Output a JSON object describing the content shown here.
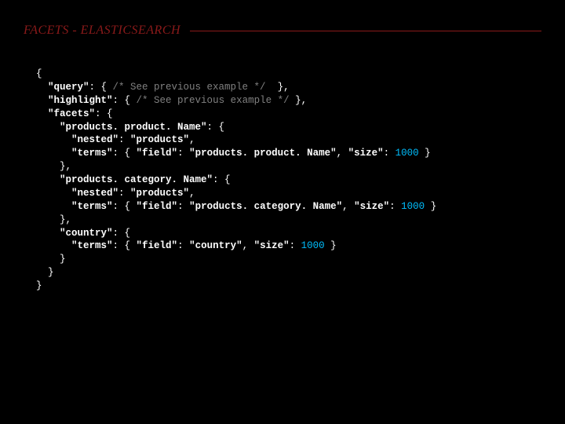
{
  "header": {
    "title": "FACETS - ELASTICSEARCH"
  },
  "code": {
    "l01": "{",
    "l02_a": "  \"query\"",
    "l02_b": ": { ",
    "l02_c": "/* See previous example */",
    "l02_d": "  },",
    "l03_a": "  \"highlight\"",
    "l03_b": ": { ",
    "l03_c": "/* See previous example */",
    "l03_d": " },",
    "l04_a": "  \"facets\"",
    "l04_b": ": {",
    "l05_a": "    \"products. product. Name\"",
    "l05_b": ": {",
    "l06_a": "      \"nested\"",
    "l06_b": ": ",
    "l06_c": "\"products\"",
    "l06_d": ",",
    "l07_a": "      \"terms\"",
    "l07_b": ": { ",
    "l07_c": "\"field\"",
    "l07_d": ": ",
    "l07_e": "\"products. product. Name\"",
    "l07_f": ", ",
    "l07_g": "\"size\"",
    "l07_h": ": ",
    "l07_i": "1000",
    "l07_j": " }",
    "l08": "    },",
    "l09_a": "    \"products. category. Name\"",
    "l09_b": ": {",
    "l10_a": "      \"nested\"",
    "l10_b": ": ",
    "l10_c": "\"products\"",
    "l10_d": ",",
    "l11_a": "      \"terms\"",
    "l11_b": ": { ",
    "l11_c": "\"field\"",
    "l11_d": ": ",
    "l11_e": "\"products. category. Name\"",
    "l11_f": ", ",
    "l11_g": "\"size\"",
    "l11_h": ": ",
    "l11_i": "1000",
    "l11_j": " }",
    "l12": "    },",
    "l13_a": "    \"country\"",
    "l13_b": ": {",
    "l14_a": "      \"terms\"",
    "l14_b": ": { ",
    "l14_c": "\"field\"",
    "l14_d": ": ",
    "l14_e": "\"country\"",
    "l14_f": ", ",
    "l14_g": "\"size\"",
    "l14_h": ": ",
    "l14_i": "1000",
    "l14_j": " }",
    "l15": "    }",
    "l16": "  }",
    "l17": "}"
  }
}
